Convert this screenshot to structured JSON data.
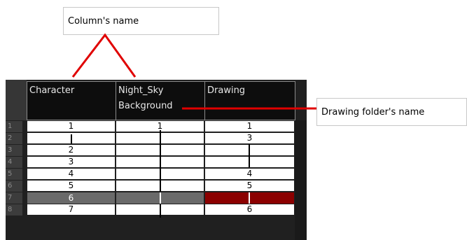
{
  "callouts": {
    "column_name": "Column's name",
    "drawing_folder_name": "Drawing folder's name"
  },
  "columns": [
    {
      "name": "Character",
      "folder": ""
    },
    {
      "name": "Night_Sky",
      "folder": "Background"
    },
    {
      "name": "Drawing",
      "folder": ""
    }
  ],
  "rows": [
    {
      "num": "1",
      "cells": [
        "1",
        "1",
        "1"
      ]
    },
    {
      "num": "2",
      "cells": [
        "",
        "",
        "3"
      ]
    },
    {
      "num": "3",
      "cells": [
        "2",
        "",
        ""
      ]
    },
    {
      "num": "4",
      "cells": [
        "3",
        "",
        ""
      ]
    },
    {
      "num": "5",
      "cells": [
        "4",
        "",
        "4"
      ]
    },
    {
      "num": "6",
      "cells": [
        "5",
        "",
        "5"
      ]
    },
    {
      "num": "7",
      "cells": [
        "6",
        "",
        ""
      ]
    },
    {
      "num": "8",
      "cells": [
        "7",
        "",
        "6"
      ]
    }
  ],
  "colors": {
    "annotation_line": "#e00000",
    "selected_row": "#6a6a6a",
    "selected_cell": "#8b0000"
  }
}
